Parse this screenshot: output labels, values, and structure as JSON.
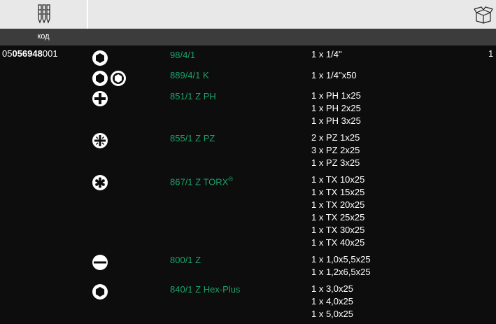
{
  "header": {
    "code_label": "код"
  },
  "icons": {
    "bits": "screwdriver-bits-icon",
    "package": "package-box-icon"
  },
  "colors": {
    "accent_green": "#1aa36a",
    "background": "#0d0d0d",
    "header_bg": "#e8e8e8",
    "subheader_bg": "#3c3c3c"
  },
  "product": {
    "code_prefix": "05",
    "code_bold": "056948",
    "code_suffix": "001",
    "quantity": "1"
  },
  "rows": [
    {
      "name": "98/4/1",
      "icon": "hex-socket-icon",
      "specs": [
        "1 x 1/4\""
      ]
    },
    {
      "name": "889/4/1 K",
      "icon": "hex-holder-icon",
      "specs": [
        "1 x 1/4\"x50"
      ]
    },
    {
      "name": "851/1 Z PH",
      "icon": "phillips-icon",
      "specs": [
        "1 x PH 1x25",
        "1 x PH 2x25",
        "1 x PH 3x25"
      ]
    },
    {
      "name": "855/1 Z PZ",
      "icon": "pozidriv-icon",
      "specs": [
        "2 x PZ 1x25",
        "3 x PZ 2x25",
        "1 x PZ 3x25"
      ]
    },
    {
      "name": "867/1 Z TORX",
      "name_sup": "®",
      "icon": "torx-icon",
      "specs": [
        "1 x TX 10x25",
        "1 x TX 15x25",
        "1 x TX 20x25",
        "1 x TX 25x25",
        "1 x TX 30x25",
        "1 x TX 40x25"
      ]
    },
    {
      "name": "800/1 Z",
      "icon": "slotted-icon",
      "specs": [
        "1 x 1,0x5,5x25",
        "1 x 1,2x6,5x25"
      ]
    },
    {
      "name": "840/1 Z Hex-Plus",
      "icon": "hex-plus-icon",
      "specs": [
        "1 x 3,0x25",
        "1 x 4,0x25",
        "1 x 5,0x25"
      ]
    }
  ]
}
